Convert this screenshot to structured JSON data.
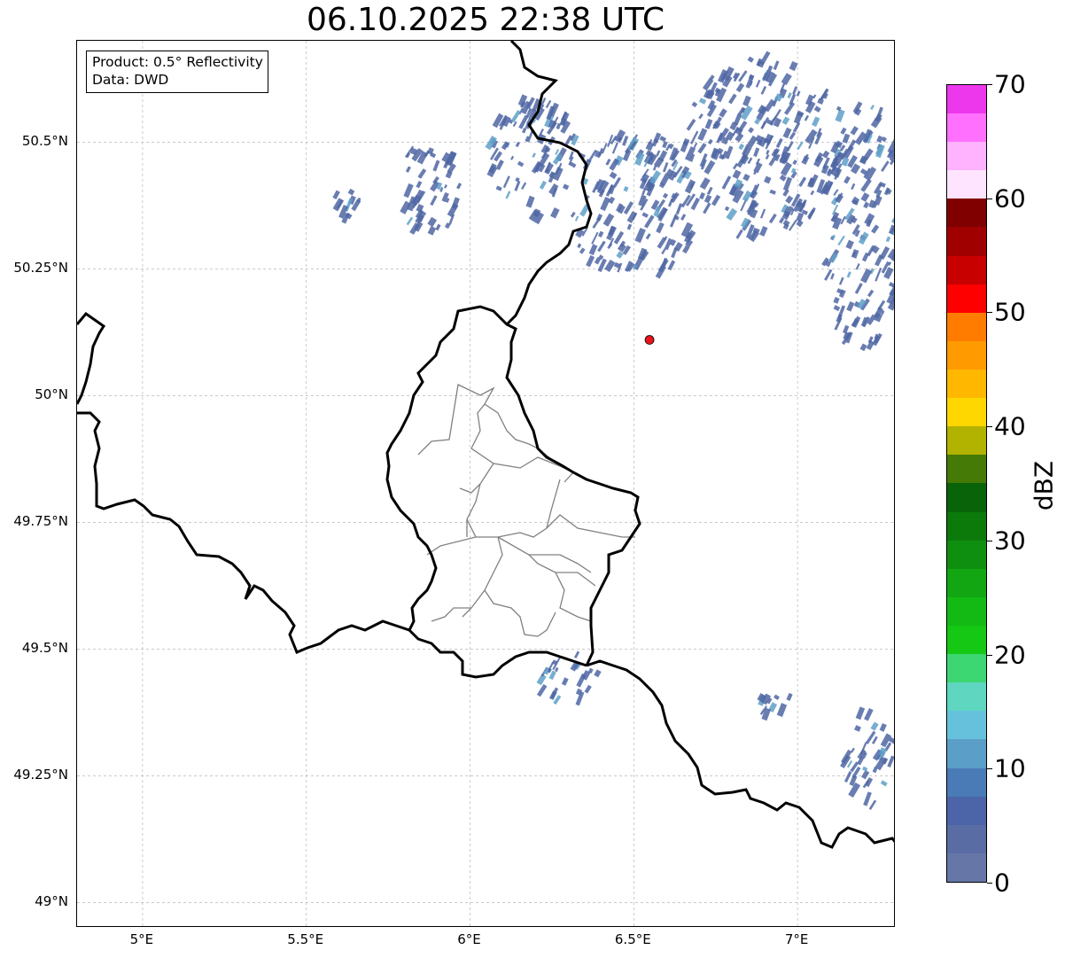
{
  "title": "06.10.2025 22:38 UTC",
  "info": {
    "product": "Product: 0.5° Reflectivity",
    "data": "Data: DWD"
  },
  "map": {
    "extent": {
      "lon_min": 4.8,
      "lon_max": 7.3,
      "lat_min": 48.95,
      "lat_max": 50.7
    },
    "lat_ticks": [
      {
        "value": 50.5,
        "label": "50.5°N"
      },
      {
        "value": 50.25,
        "label": "50.25°N"
      },
      {
        "value": 50.0,
        "label": "50°N"
      },
      {
        "value": 49.75,
        "label": "49.75°N"
      },
      {
        "value": 49.5,
        "label": "49.5°N"
      },
      {
        "value": 49.25,
        "label": "49.25°N"
      },
      {
        "value": 49.0,
        "label": "49°N"
      }
    ],
    "lon_ticks": [
      {
        "value": 5.0,
        "label": "5°E"
      },
      {
        "value": 5.5,
        "label": "5.5°E"
      },
      {
        "value": 6.0,
        "label": "6°E"
      },
      {
        "value": 6.5,
        "label": "6.5°E"
      },
      {
        "value": 7.0,
        "label": "7°E"
      }
    ],
    "radar_site": {
      "lon": 6.548,
      "lat": 50.11,
      "color": "#e8141c"
    },
    "echo_color": "#4f66a3",
    "echo_light_color": "#5fa0c8",
    "echo_cells": [
      {
        "lon": 5.88,
        "lat": 50.42,
        "rx": 0.09,
        "ry": 0.1
      },
      {
        "lon": 5.62,
        "lat": 50.38,
        "rx": 0.05,
        "ry": 0.04
      },
      {
        "lon": 6.2,
        "lat": 50.48,
        "rx": 0.15,
        "ry": 0.12
      },
      {
        "lon": 6.5,
        "lat": 50.38,
        "rx": 0.2,
        "ry": 0.15
      },
      {
        "lon": 6.9,
        "lat": 50.5,
        "rx": 0.25,
        "ry": 0.18
      },
      {
        "lon": 7.2,
        "lat": 50.35,
        "rx": 0.12,
        "ry": 0.25
      },
      {
        "lon": 6.3,
        "lat": 49.45,
        "rx": 0.09,
        "ry": 0.05
      },
      {
        "lon": 7.22,
        "lat": 49.3,
        "rx": 0.07,
        "ry": 0.1
      },
      {
        "lon": 6.93,
        "lat": 49.4,
        "rx": 0.07,
        "ry": 0.03
      }
    ]
  },
  "colorbar": {
    "label": "dBZ",
    "min": 0,
    "max": 70,
    "ticks": [
      "0",
      "10",
      "20",
      "30",
      "40",
      "50",
      "60",
      "70"
    ],
    "colors": [
      "#6677a7",
      "#5a6ca4",
      "#4c64a8",
      "#4a7bb6",
      "#5b9ec8",
      "#66c2dc",
      "#5ed6c0",
      "#3cd672",
      "#14c814",
      "#13ba13",
      "#12a612",
      "#0f8f0f",
      "#0b7a0b",
      "#096309",
      "#457a06",
      "#b2b200",
      "#ffd700",
      "#ffb700",
      "#ff9a00",
      "#ff7c00",
      "#ff0000",
      "#c80000",
      "#a00000",
      "#800000",
      "#ffe4ff",
      "#ffb3ff",
      "#ff70ff",
      "#ed37ed"
    ]
  }
}
